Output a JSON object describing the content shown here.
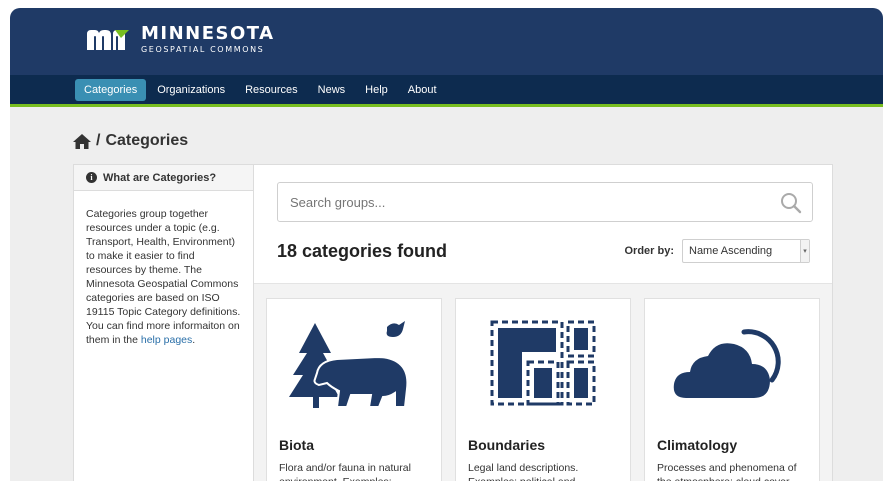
{
  "header": {
    "logo_title": "MINNESOTA",
    "logo_subtitle": "GEOSPATIAL COMMONS"
  },
  "nav": [
    {
      "label": "Categories",
      "active": true
    },
    {
      "label": "Organizations"
    },
    {
      "label": "Resources"
    },
    {
      "label": "News"
    },
    {
      "label": "Help"
    },
    {
      "label": "About"
    }
  ],
  "breadcrumb": {
    "separator": "/",
    "current": "Categories"
  },
  "sidebar": {
    "heading": "What are Categories?",
    "paragraph_1": "Categories group together resources under a topic (e.g. Transport, Health, Environment) to make it easier to find resources by theme. The Minnesota Geospatial Commons categories are based on ISO 19115 Topic Category definitions. You can find more informaiton on them in the",
    "link_text": "help pages",
    "paragraph_end": "."
  },
  "search": {
    "placeholder": "Search groups..."
  },
  "results": {
    "count_text": "18 categories found"
  },
  "order": {
    "label": "Order by:",
    "selected": "Name Ascending"
  },
  "cards": [
    {
      "title": "Biota",
      "description": "Flora and/or fauna in natural environment. Examples:",
      "icon": "bear-tree-bird-icon"
    },
    {
      "title": "Boundaries",
      "description": "Legal land descriptions. Examples: political and",
      "icon": "boundaries-icon"
    },
    {
      "title": "Climatology",
      "description": "Processes and phenomena of the atmosphere: cloud cover",
      "icon": "cloud-sun-icon"
    }
  ],
  "colors": {
    "header_bg": "#1f3a66",
    "nav_bg": "#0d2b4f",
    "nav_active": "#3a8fb3",
    "accent_green": "#78be20",
    "icon_blue": "#1f3a66"
  }
}
